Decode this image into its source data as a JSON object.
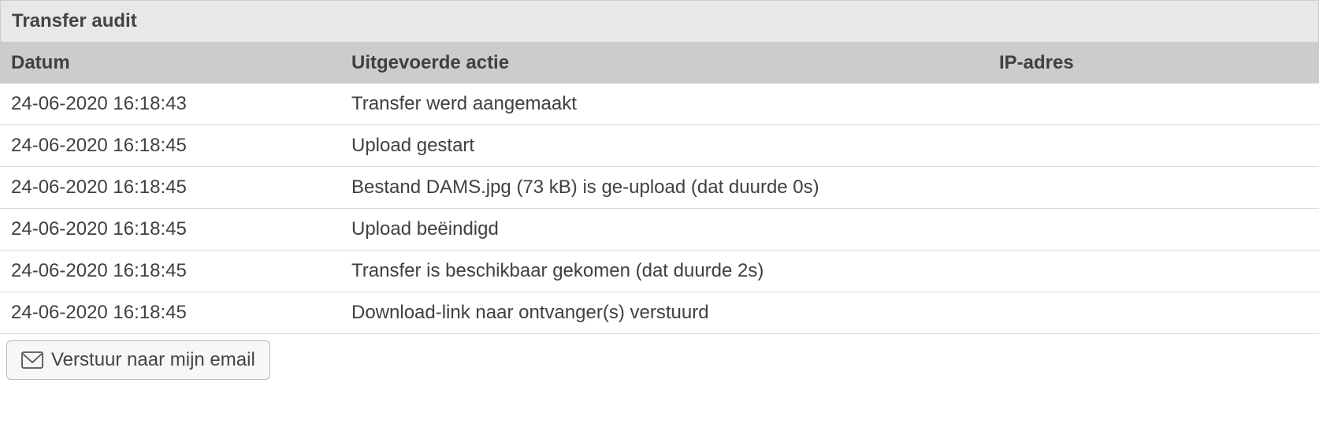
{
  "panel": {
    "title": "Transfer audit"
  },
  "table": {
    "headers": {
      "date": "Datum",
      "action": "Uitgevoerde actie",
      "ip": "IP-adres"
    },
    "rows": [
      {
        "date": "24-06-2020 16:18:43",
        "action": "Transfer werd aangemaakt",
        "ip": ""
      },
      {
        "date": "24-06-2020 16:18:45",
        "action": "Upload gestart",
        "ip": ""
      },
      {
        "date": "24-06-2020 16:18:45",
        "action": "Bestand DAMS.jpg (73 kB) is ge-upload (dat duurde 0s)",
        "ip": ""
      },
      {
        "date": "24-06-2020 16:18:45",
        "action": "Upload beëindigd",
        "ip": ""
      },
      {
        "date": "24-06-2020 16:18:45",
        "action": "Transfer is beschikbaar gekomen (dat duurde 2s)",
        "ip": ""
      },
      {
        "date": "24-06-2020 16:18:45",
        "action": "Download-link naar ontvanger(s) verstuurd",
        "ip": ""
      }
    ]
  },
  "footer": {
    "email_button_label": "Verstuur naar mijn email"
  }
}
